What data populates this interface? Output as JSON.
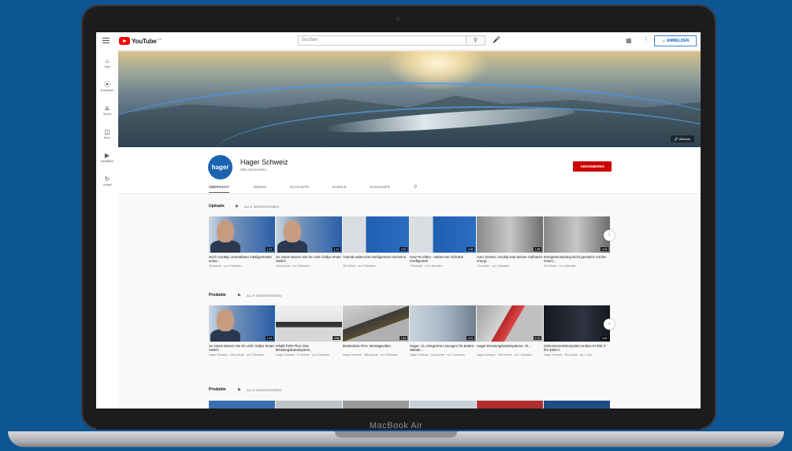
{
  "device": {
    "model": "MacBook Air"
  },
  "header": {
    "logo_text": "YouTube",
    "logo_country": "CH",
    "search_placeholder": "Suchen",
    "signin_label": "ANMELDEN"
  },
  "sidebar": {
    "items": [
      {
        "icon": "home-icon",
        "label": "Start"
      },
      {
        "icon": "explore-icon",
        "label": "Entdecken"
      },
      {
        "icon": "shorts-icon",
        "label": "Shorts"
      },
      {
        "icon": "subscriptions-icon",
        "label": "Abos"
      },
      {
        "icon": "library-icon",
        "label": "Mediathek"
      },
      {
        "icon": "history-icon",
        "label": "Verlauf"
      }
    ]
  },
  "banner": {
    "link_label": "Website"
  },
  "channel": {
    "avatar_text": "hager",
    "name": "Hager Schweiz",
    "subscribers": "985 Abonnenten",
    "subscribe_label": "ABONNIEREN",
    "tabs": [
      "ÜBERSICHT",
      "VIDEOS",
      "PLAYLISTS",
      "KANÄLE",
      "KANALINFO"
    ]
  },
  "shelves": [
    {
      "title": "Uploads",
      "all_label": "ALLE WIEDERGEBEN",
      "videos": [
        {
          "title": "Noch vorrätig: umrüstbarer intelligentester unsre...",
          "meta": "48 Aufrufe · vor 3 Monaten",
          "duration": "1:47",
          "style": "face-blue"
        },
        {
          "title": "So smart steuern Sie Ihr Licht: hallyo Smart Switch",
          "meta": "164 Aufrufe · vor 3 Monaten",
          "duration": "1:47",
          "style": "face-blue"
        },
        {
          "title": "Tutorial weber.mer konfigurieren Gemeine",
          "meta": "38 Aufrufe · vor 3 Monaten",
          "duration": "2:57",
          "style": "room-blue"
        },
        {
          "title": "How-To-Video - weber.mer Schrank Konfigurator",
          "meta": "73 Aufrufe · vor 3 Monaten",
          "duration": "3:05",
          "style": "room-blue"
        },
        {
          "title": "Auto ziemen, revoltiq smp beinen Caffvacht energi...",
          "meta": "72 Aufrufe · vor 4 Monaten",
          "duration": "1:58",
          "style": "people-grey"
        },
        {
          "title": "Energiemonitoring leicht gemacht: mit der neuen...",
          "meta": "60 Aufrufe · vor 4 Monaten",
          "duration": "0:45",
          "style": "people-grey"
        }
      ]
    },
    {
      "title": "Produkte",
      "all_label": "ALLE WIEDERGEBEN",
      "videos": [
        {
          "title": "So smart steuern Sie Ihr Licht: hallyo Smart Switch",
          "meta": "Hager Schweiz · 164 Aufrufe · vor 3 Monaten",
          "duration": "1:47",
          "style": "face-blue"
        },
        {
          "title": "tehalit FWK Plus: Das Brüstungskanalsystem...",
          "meta": "Hager Schweiz · 27 Aufrufe · vor 6 Monaten",
          "duration": "0:58",
          "style": "office"
        },
        {
          "title": "Bodendose PAH: Montagevideo",
          "meta": "Hager Schweiz · 285 Aufrufe · vor 3 Monaten",
          "duration": "2:24",
          "style": "floor"
        },
        {
          "title": "Hager: CLI integrierte Lösungen für Boden, Wände...",
          "meta": "Hager Schweiz · 118 Aufrufe · vor 4 Monaten",
          "duration": "4:21",
          "style": "room-light"
        },
        {
          "title": "Hager Brüstungskanalsysteme: Gl...",
          "meta": "Hager Schweiz · 100 Aufrufe · vor 7 Monaten",
          "duration": "1:13",
          "style": "red-floor"
        },
        {
          "title": "Schienenverteilersystem unibox KI 300 3-fire 4000 A",
          "meta": "Hager Schweiz · 85 Aufrufe · vor 1 Jahr",
          "duration": "0:44",
          "style": "dark"
        }
      ]
    },
    {
      "title": "Produkte",
      "all_label": "ALLE WIEDERGEBEN",
      "videos": []
    }
  ],
  "colors": {
    "background": "#0e5593",
    "subscribe": "#cc0000",
    "youtube_red": "#ff0000",
    "hager_blue": "#1a63b0"
  }
}
